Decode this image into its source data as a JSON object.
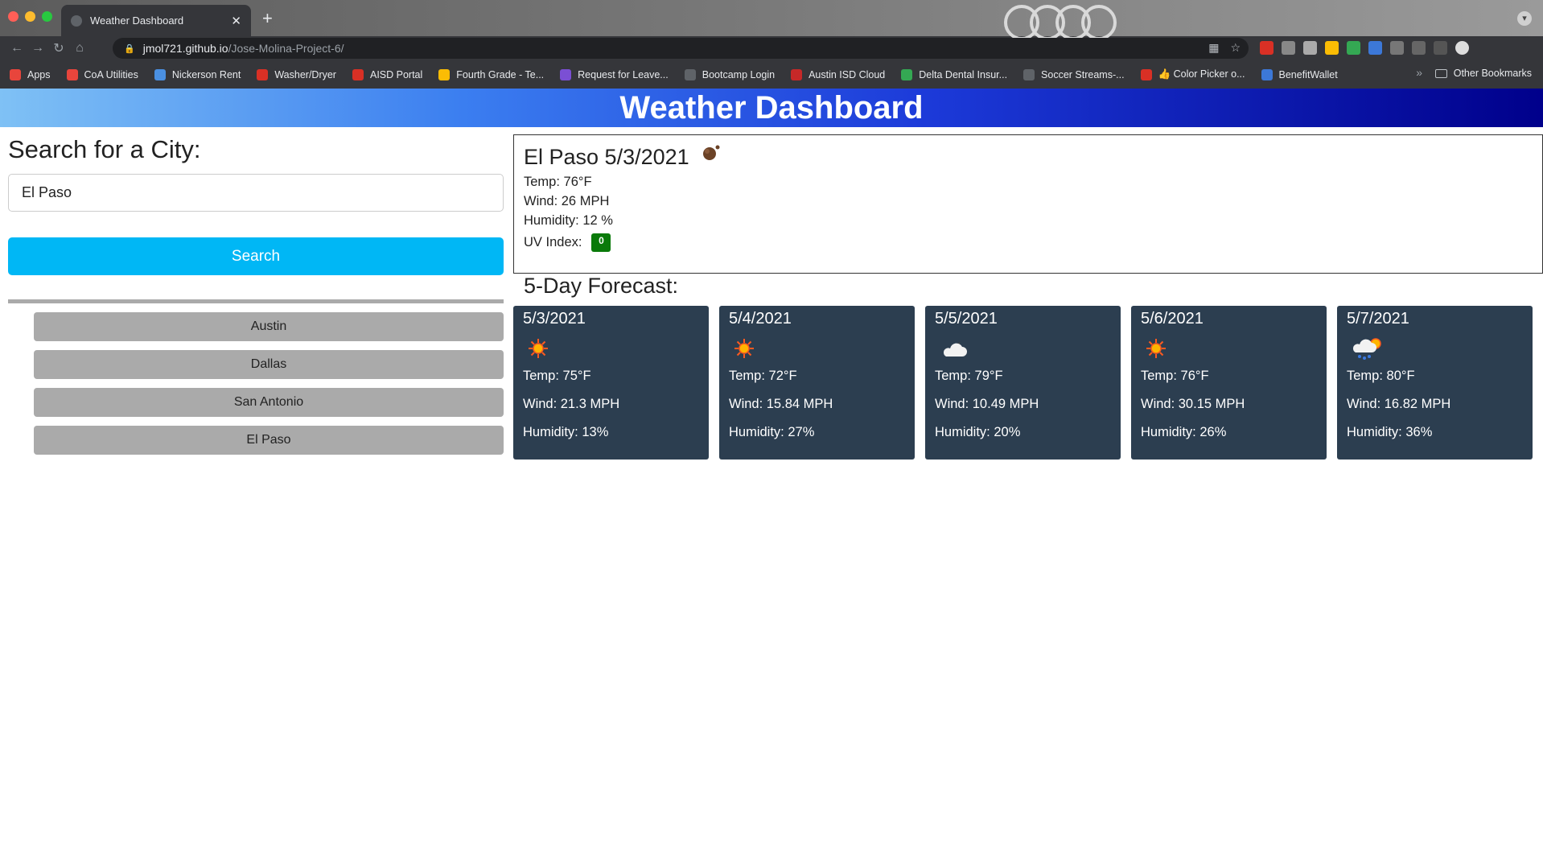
{
  "browser": {
    "tab_title": "Weather Dashboard",
    "url_host": "jmol721.github.io",
    "url_path": "/Jose-Molina-Project-6/",
    "bookmarks": [
      {
        "label": "Apps",
        "color": "#e8453c"
      },
      {
        "label": "CoA Utilities",
        "color": "#e8453c"
      },
      {
        "label": "Nickerson Rent",
        "color": "#4a90e2"
      },
      {
        "label": "Washer/Dryer",
        "color": "#d93025"
      },
      {
        "label": "AISD Portal",
        "color": "#d93025"
      },
      {
        "label": "Fourth Grade - Te...",
        "color": "#fbbc04"
      },
      {
        "label": "Request for Leave...",
        "color": "#7b4fd4"
      },
      {
        "label": "Bootcamp Login",
        "color": "#5f6368"
      },
      {
        "label": "Austin ISD Cloud",
        "color": "#c62828"
      },
      {
        "label": "Delta Dental Insur...",
        "color": "#34a853"
      },
      {
        "label": "Soccer Streams-...",
        "color": "#5f6368"
      },
      {
        "label": "👍 Color Picker o...",
        "color": "#d93025"
      },
      {
        "label": "BenefitWallet",
        "color": "#3c78d8"
      }
    ],
    "other_bookmarks": "Other Bookmarks"
  },
  "header": {
    "title": "Weather Dashboard"
  },
  "search": {
    "heading": "Search for a City:",
    "value": "El Paso",
    "button_label": "Search"
  },
  "history": [
    "Austin",
    "Dallas",
    "San Antonio",
    "El Paso"
  ],
  "current": {
    "city_date": "El Paso 5/3/2021",
    "icon": "haze-icon",
    "temp": "Temp: 76°F",
    "wind": "Wind: 26 MPH",
    "humidity": "Humidity: 12 %",
    "uv_label": "UV Index:",
    "uv_value": "0",
    "uv_color": "#0a7a0a"
  },
  "forecast": {
    "title": "5-Day Forecast:",
    "days": [
      {
        "date": "5/3/2021",
        "icon": "sun-icon",
        "temp": "Temp: 75°F",
        "wind": "Wind: 21.3 MPH",
        "humidity": "Humidity: 13%"
      },
      {
        "date": "5/4/2021",
        "icon": "sun-icon",
        "temp": "Temp: 72°F",
        "wind": "Wind: 15.84 MPH",
        "humidity": "Humidity: 27%"
      },
      {
        "date": "5/5/2021",
        "icon": "cloud-night-icon",
        "temp": "Temp: 79°F",
        "wind": "Wind: 10.49 MPH",
        "humidity": "Humidity: 20%"
      },
      {
        "date": "5/6/2021",
        "icon": "sun-icon",
        "temp": "Temp: 76°F",
        "wind": "Wind: 30.15 MPH",
        "humidity": "Humidity: 26%"
      },
      {
        "date": "5/7/2021",
        "icon": "rain-sun-icon",
        "temp": "Temp: 80°F",
        "wind": "Wind: 16.82 MPH",
        "humidity": "Humidity: 36%"
      }
    ]
  },
  "colors": {
    "card_bg": "#2c3e50",
    "search_button": "#00b7f5",
    "history_button": "#aaaaaa"
  }
}
